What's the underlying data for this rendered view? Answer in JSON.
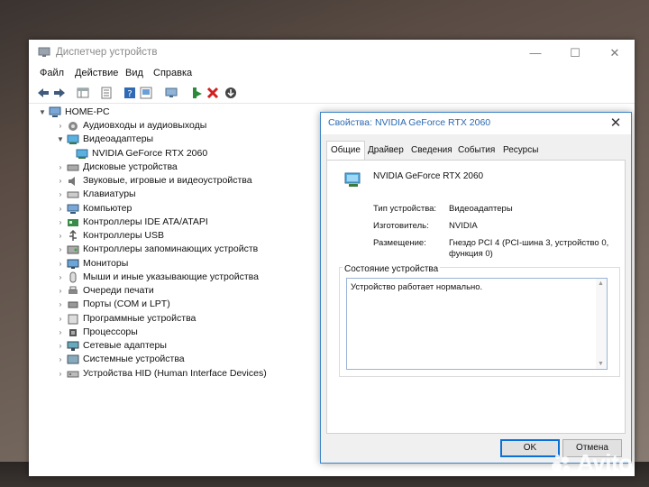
{
  "window": {
    "title": "Диспетчер устройств",
    "minimize_glyph": "—",
    "maximize_glyph": "☐",
    "close_glyph": "✕"
  },
  "menu": [
    "Файл",
    "Действие",
    "Вид",
    "Справка"
  ],
  "toolbar_icons": [
    "back-arrow-icon",
    "forward-arrow-icon",
    "properties-grid-icon",
    "properties-icon",
    "help-icon",
    "show-hidden-icon",
    "scan-hardware-icon",
    "update-driver-icon",
    "uninstall-icon",
    "disable-device-icon"
  ],
  "tree": {
    "root": "HOME-PC",
    "items": [
      {
        "label": "Аудиовходы и аудиовыходы",
        "expanded": false,
        "icon": "audio-io-icon"
      },
      {
        "label": "Видеоадаптеры",
        "expanded": true,
        "icon": "display-adapter-icon"
      },
      {
        "label": "NVIDIA GeForce RTX 2060",
        "child": true,
        "icon": "gpu-icon"
      },
      {
        "label": "Дисковые устройства",
        "expanded": false,
        "icon": "disk-icon"
      },
      {
        "label": "Звуковые, игровые и видеоустройства",
        "expanded": false,
        "icon": "sound-icon"
      },
      {
        "label": "Клавиатуры",
        "expanded": false,
        "icon": "keyboard-icon"
      },
      {
        "label": "Компьютер",
        "expanded": false,
        "icon": "computer-icon"
      },
      {
        "label": "Контроллеры IDE ATA/ATAPI",
        "expanded": false,
        "icon": "ide-icon"
      },
      {
        "label": "Контроллеры USB",
        "expanded": false,
        "icon": "usb-icon"
      },
      {
        "label": "Контроллеры запоминающих устройств",
        "expanded": false,
        "icon": "storage-controller-icon"
      },
      {
        "label": "Мониторы",
        "expanded": false,
        "icon": "monitor-icon"
      },
      {
        "label": "Мыши и иные указывающие устройства",
        "expanded": false,
        "icon": "mouse-icon"
      },
      {
        "label": "Очереди печати",
        "expanded": false,
        "icon": "printer-icon"
      },
      {
        "label": "Порты (COM и LPT)",
        "expanded": false,
        "icon": "port-icon"
      },
      {
        "label": "Программные устройства",
        "expanded": false,
        "icon": "software-device-icon"
      },
      {
        "label": "Процессоры",
        "expanded": false,
        "icon": "cpu-icon"
      },
      {
        "label": "Сетевые адаптеры",
        "expanded": false,
        "icon": "network-icon"
      },
      {
        "label": "Системные устройства",
        "expanded": false,
        "icon": "system-device-icon"
      },
      {
        "label": "Устройства HID (Human Interface Devices)",
        "expanded": false,
        "icon": "hid-icon"
      }
    ]
  },
  "dialog": {
    "title": "Свойства: NVIDIA GeForce RTX 2060",
    "close_glyph": "✕",
    "tabs": [
      "Общие",
      "Драйвер",
      "Сведения",
      "События",
      "Ресурсы"
    ],
    "active_tab": 0,
    "device_name": "NVIDIA GeForce RTX 2060",
    "fields": [
      {
        "key": "Тип устройства:",
        "value": "Видеоадаптеры"
      },
      {
        "key": "Изготовитель:",
        "value": "NVIDIA"
      },
      {
        "key": "Размещение:",
        "value": "Гнездо PCI 4 (PCI-шина 3, устройство 0, функция 0)"
      }
    ],
    "status_group": "Состояние устройства",
    "status_text": "Устройство работает нормально.",
    "ok_label": "OK",
    "cancel_label": "Отмена"
  },
  "watermark": "Avito",
  "colors": {
    "accent": "#0a6fd6",
    "dialog_title": "#2a6ab0",
    "selection_border": "#3c84c8"
  }
}
